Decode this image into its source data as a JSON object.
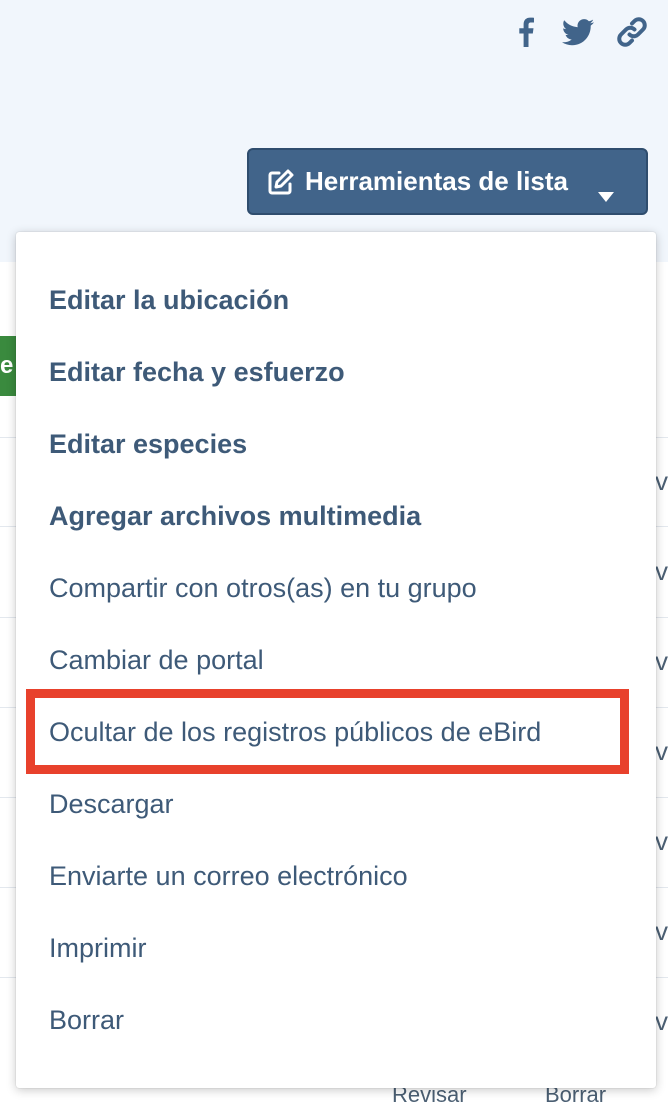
{
  "share": {
    "icons": [
      "facebook-icon",
      "twitter-icon",
      "link-icon"
    ]
  },
  "tools_button": {
    "label": "Herramientas de lista",
    "icon": "edit-icon",
    "caret_icon": "caret-down-icon"
  },
  "background": {
    "tab_fragment": "e",
    "edge_fragments": [
      "ve",
      "ve",
      "ve",
      "ve",
      "ve",
      "ve",
      "ve"
    ],
    "bottom_fragments": [
      "Revisar",
      "Borrar"
    ]
  },
  "menu": {
    "items": [
      {
        "label": "Editar la ubicación"
      },
      {
        "label": "Editar fecha y esfuerzo"
      },
      {
        "label": "Editar especies"
      },
      {
        "label": "Agregar archivos multimedia"
      },
      {
        "label": "Compartir con otros(as) en tu grupo"
      },
      {
        "label": "Cambiar de portal"
      },
      {
        "label": "Ocultar de los registros públicos de eBird"
      },
      {
        "label": "Descargar"
      },
      {
        "label": "Enviarte un correo electrónico"
      },
      {
        "label": "Imprimir"
      },
      {
        "label": "Borrar"
      }
    ],
    "highlighted_index": 6
  },
  "colors": {
    "header_bg": "#f1f6fc",
    "button_bg": "#41648a",
    "menu_text": "#3e5a78",
    "highlight": "#e8412c",
    "tab_green": "#3a8a3e"
  }
}
